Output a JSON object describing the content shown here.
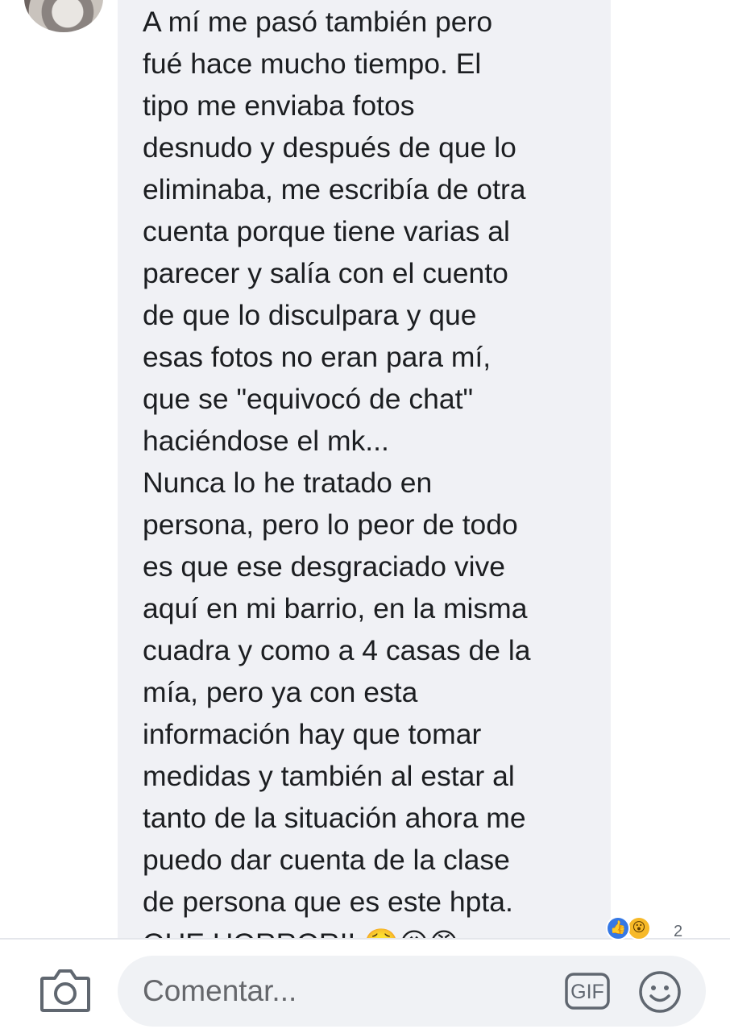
{
  "comment": {
    "text": "A mí me pasó también pero\nfué hace mucho tiempo. El\ntipo me enviaba fotos\ndesnudo y después de que lo\neliminaba, me escribía de otra\ncuenta porque tiene varias al\nparecer y salía con el cuento\nde que lo disculpara y que\nesas fotos no eran para mí,\nque se \"equivocó de chat\"\nhaciéndose el mk...\nNunca lo he tratado en\npersona, pero lo peor de todo\nes que ese desgraciado vive\naquí en mi barrio, en la misma\ncuadra y como a 4 casas de la\nmía, pero ya con esta\ninformación hay que tomar\nmedidas y también al estar al\ntanto de la situación ahora me\npuedo dar cuenta de la clase\nde persona que es este hpta.\nQUE HORROR!! 🤮😖😡",
    "reactions": {
      "icons": [
        "like-icon",
        "wow-icon"
      ],
      "count": "2"
    }
  },
  "composer": {
    "placeholder": "Comentar...",
    "gif_label": "GIF",
    "icons": [
      "camera-icon",
      "gif-icon",
      "emoji-icon"
    ]
  },
  "colors": {
    "bubble": "#f0f1f5",
    "text": "#1c1e21",
    "placeholder": "#65676b",
    "like": "#3578e5",
    "wow": "#f7b928"
  }
}
